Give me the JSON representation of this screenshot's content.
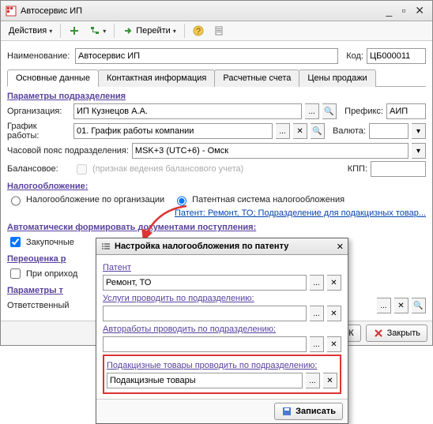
{
  "window_title": "Автосервис ИП",
  "toolbar": {
    "actions_label": "Действия"
  },
  "main": {
    "name_label": "Наименование:",
    "name_value": "Автосервис ИП",
    "code_label": "Код:",
    "code_value": "ЦБ000011"
  },
  "tabs": [
    "Основные данные",
    "Контактная информация",
    "Расчетные счета",
    "Цены продажи"
  ],
  "params_title": "Параметры подразделения",
  "org_label": "Организация:",
  "org_value": "ИП Кузнецов А.А.",
  "prefix_label": "Префикс:",
  "prefix_value": "АИП",
  "schedule_label": "График работы:",
  "schedule_value": "01. График работы компании",
  "currency_label": "Валюта:",
  "currency_value": "",
  "timezone_label": "Часовой пояс подразделения:",
  "timezone_value": "MSK+3 (UTC+6) - Омск",
  "balance_label": "Балансовое:",
  "balance_check_label": "(признак ведения балансового учета)",
  "kpp_label": "КПП:",
  "kpp_value": "",
  "tax_title": "Налогообложение:",
  "tax_radio1": "Налогообложение по организации",
  "tax_radio2": "Патентная система налогообложения",
  "patent_link": "Патент: Ремонт, ТО; Подразделение для подакцизных товар...",
  "auto_title": "Автоматически формировать документами поступления:",
  "purchase_label": "Закупочные",
  "reval_title": "Переоценка р",
  "on_receipt_label": "При оприход",
  "goods_params_title": "Параметры т",
  "responsible_label": "Ответственный",
  "footer_ok": "ОК",
  "footer_close": "Закрыть",
  "perейти": "Перейти",
  "popup": {
    "title": "Настройка налогообложения по патенту",
    "patent_label": "Патент",
    "patent_value": "Ремонт, ТО",
    "services_label": "Услуги проводить по подразделению:",
    "services_value": "",
    "autoworks_label": "Автоработы проводить по подразделению:",
    "autoworks_value": "",
    "excise_label": "Подакцизные товары проводить по подразделению:",
    "excise_value": "Подакцизные товары",
    "save_label": "Записать"
  }
}
